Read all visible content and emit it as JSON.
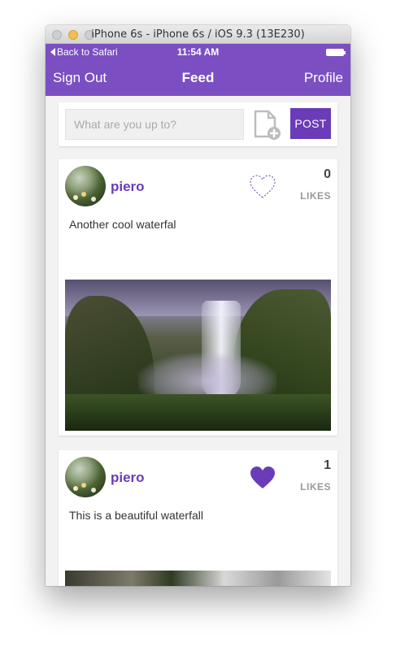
{
  "simulator": {
    "title": "iPhone 6s - iPhone 6s / iOS 9.3 (13E230)"
  },
  "statusbar": {
    "back_label": "Back to Safari",
    "time": "11:54 AM"
  },
  "navbar": {
    "left_label": "Sign Out",
    "title": "Feed",
    "right_label": "Profile"
  },
  "composer": {
    "placeholder": "What are you up to?",
    "post_label": "POST",
    "attach_icon": "add-file-icon"
  },
  "posts": [
    {
      "author": "piero",
      "likes": "0",
      "likes_label": "LIKES",
      "liked": false,
      "text": "Another cool waterfal"
    },
    {
      "author": "piero",
      "likes": "1",
      "likes_label": "LIKES",
      "liked": true,
      "text": "This is a beautiful waterfall"
    }
  ],
  "colors": {
    "accent": "#7b4fc2",
    "button": "#6a3cb8",
    "background": "#f2f2f2"
  }
}
